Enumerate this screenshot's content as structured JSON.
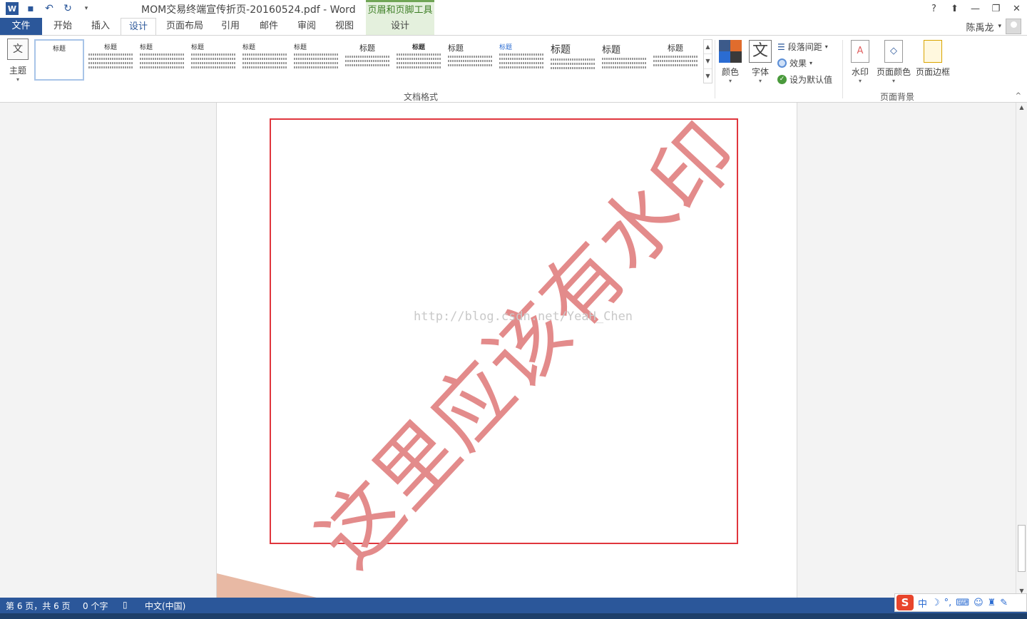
{
  "window": {
    "title": "MOM交易终端宣传折页-20160524.pdf - Word",
    "context_group": "页眉和页脚工具",
    "help": "?",
    "restore_ribbon": "⬆",
    "minimize": "—",
    "maximize": "❐",
    "close": "✕"
  },
  "qat": {
    "undo": "↶",
    "redo": "↻",
    "more": "▾"
  },
  "tabs": [
    "文件",
    "开始",
    "插入",
    "设计",
    "页面布局",
    "引用",
    "邮件",
    "审阅",
    "视图",
    "设计"
  ],
  "active_tab": "设计",
  "user": {
    "name": "陈禹龙",
    "caret": "▾"
  },
  "ribbon": {
    "theme_label": "主题",
    "theme_glyph": "文",
    "gallery_heading": "标题",
    "gallery_group": "文档格式",
    "colors_label": "颜色",
    "fonts_label": "字体",
    "fonts_glyph": "文",
    "para_spacing": "段落间距",
    "effects": "效果",
    "set_default": "设为默认值",
    "watermark": "水印",
    "page_color": "页面颜色",
    "page_borders": "页面边框",
    "page_bg_group": "页面背景"
  },
  "document": {
    "watermark_text": "这里应该有水印",
    "overlay_url": "http://blog.csdn.net/YeaH_Chen"
  },
  "status": {
    "page": "第 6 页，共 6 页",
    "words": "0 个字",
    "lang": "中文(中国)"
  },
  "ime": {
    "logo": "S",
    "mode": "中"
  },
  "colors": {
    "accent": "#2b579a",
    "frame": "#e0363d",
    "watermark": "#e38b8b"
  }
}
